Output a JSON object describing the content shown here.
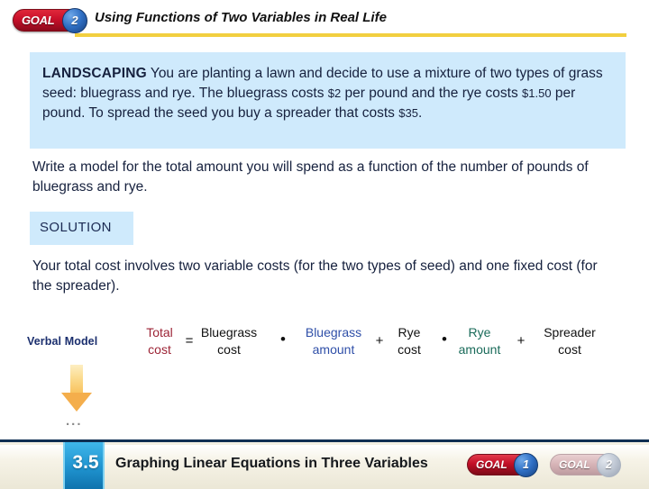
{
  "header": {
    "goal_badge": {
      "word": "GOAL",
      "number": "2"
    },
    "title": "Using Functions of Two Variables in Real Life"
  },
  "problem": {
    "keyword": "LANDSCAPING",
    "part1": " You are planting a lawn and decide to use a mixture of two types of grass seed: bluegrass and rye. The bluegrass costs ",
    "amount1": "$2",
    "part2": " per pound and the rye costs ",
    "amount2": "$1.50",
    "part3": " per pound. To spread the seed you buy a spreader that costs ",
    "amount3": "$35",
    "part4": "."
  },
  "question": "Write a model for the total amount you will spend as a function of the number of pounds of bluegrass and rye.",
  "solution": {
    "label": "SOLUTION",
    "explanation": "Your total cost involves two variable costs (for the two types of seed) and one fixed cost (for the spreader)."
  },
  "verbal_model": {
    "label": "Verbal Model",
    "terms": [
      {
        "line1": "Total",
        "line2": "cost",
        "color": "#9c2335"
      },
      {
        "line1": "Bluegrass",
        "line2": "cost",
        "color": "#111111"
      },
      {
        "line1": "Bluegrass",
        "line2": "amount",
        "color": "#2f4fa8"
      },
      {
        "line1": "Rye",
        "line2": "cost",
        "color": "#111111"
      },
      {
        "line1": "Rye",
        "line2": "amount",
        "color": "#1a6b5a"
      },
      {
        "line1": "Spreader",
        "line2": "cost",
        "color": "#111111"
      }
    ],
    "operators": [
      "=",
      "•",
      "+",
      "•",
      "+"
    ],
    "continuation": "..."
  },
  "footer": {
    "section_number": "3.5",
    "title": "Graphing Linear Equations in Three Variables",
    "goals": [
      {
        "word": "GOAL",
        "number": "1",
        "state": "active"
      },
      {
        "word": "GOAL",
        "number": "2",
        "state": "inactive"
      }
    ]
  },
  "colors": {
    "accent_gold": "#f2cf3f",
    "panel_blue": "#cfeafc",
    "goal_red": "#c8102a",
    "goal_circle_blue": "#2f6fc4",
    "footer_cream": "#f2efe2",
    "section_blue": "#29a3dc",
    "arrow_orange": "#f4ae4c"
  }
}
